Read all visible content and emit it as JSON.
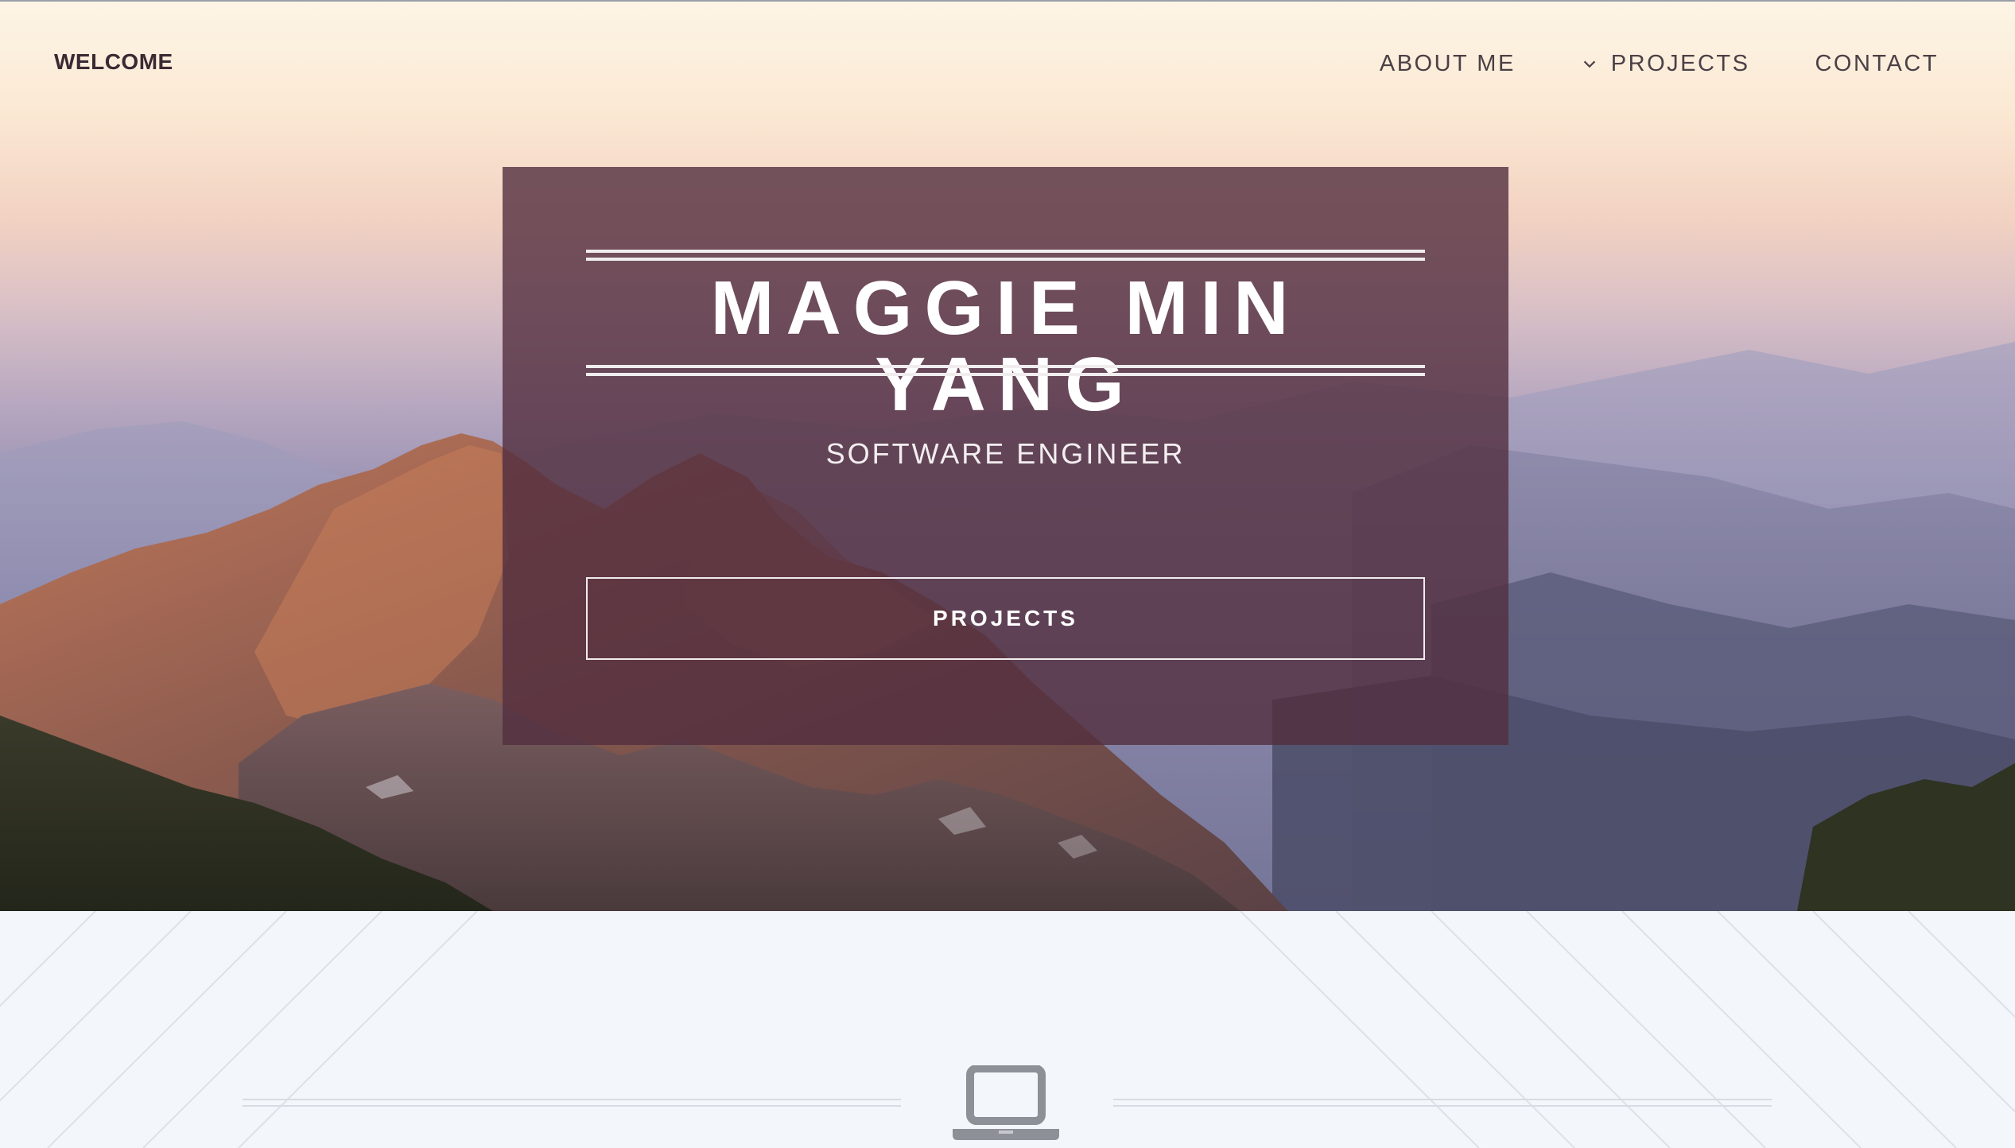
{
  "header": {
    "brand": "WELCOME",
    "nav": [
      {
        "label": "ABOUT ME",
        "icon": ""
      },
      {
        "label": "PROJECTS",
        "icon": "chevron-down-icon"
      },
      {
        "label": "CONTACT",
        "icon": ""
      }
    ]
  },
  "hero": {
    "name": "MAGGIE MIN YANG",
    "subtitle": "SOFTWARE ENGINEER",
    "cta_label": "PROJECTS",
    "overlay_color": "#522e3e"
  },
  "section": {
    "icon": "laptop-icon"
  },
  "colors": {
    "nav_text": "#4b4046",
    "brand_text": "#3b2a33",
    "lower_bg": "#f3f6fa"
  }
}
